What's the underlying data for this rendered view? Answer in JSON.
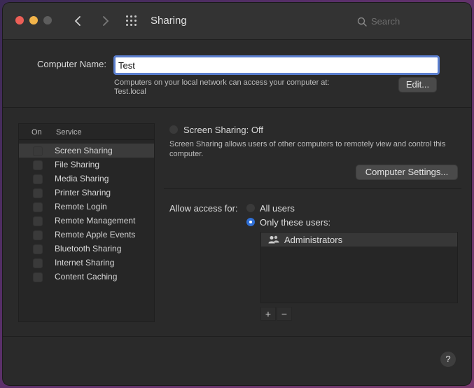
{
  "window": {
    "title": "Sharing"
  },
  "toolbar": {
    "search_placeholder": "Search",
    "back_glyph": "‹",
    "forward_glyph": "›"
  },
  "computer_name": {
    "label": "Computer Name:",
    "value": "Test",
    "help_line1": "Computers on your local network can access your computer at:",
    "help_line2": "Test.local",
    "edit_label": "Edit..."
  },
  "services": {
    "col_on": "On",
    "col_service": "Service",
    "items": [
      {
        "label": "Screen Sharing"
      },
      {
        "label": "File Sharing"
      },
      {
        "label": "Media Sharing"
      },
      {
        "label": "Printer Sharing"
      },
      {
        "label": "Remote Login"
      },
      {
        "label": "Remote Management"
      },
      {
        "label": "Remote Apple Events"
      },
      {
        "label": "Bluetooth Sharing"
      },
      {
        "label": "Internet Sharing"
      },
      {
        "label": "Content Caching"
      }
    ],
    "selected_index": 0
  },
  "detail": {
    "status": "Screen Sharing: Off",
    "description": "Screen Sharing allows users of other computers to remotely view and control this computer.",
    "computer_settings_label": "Computer Settings...",
    "allow_label": "Allow access for:",
    "option_all": "All users",
    "option_only": "Only these users:",
    "users": [
      {
        "label": "Administrators"
      }
    ],
    "plus": "+",
    "minus": "−"
  },
  "help_glyph": "?",
  "colors": {
    "accent": "#2f6fd6",
    "focus_ring": "#5b7fcf"
  }
}
